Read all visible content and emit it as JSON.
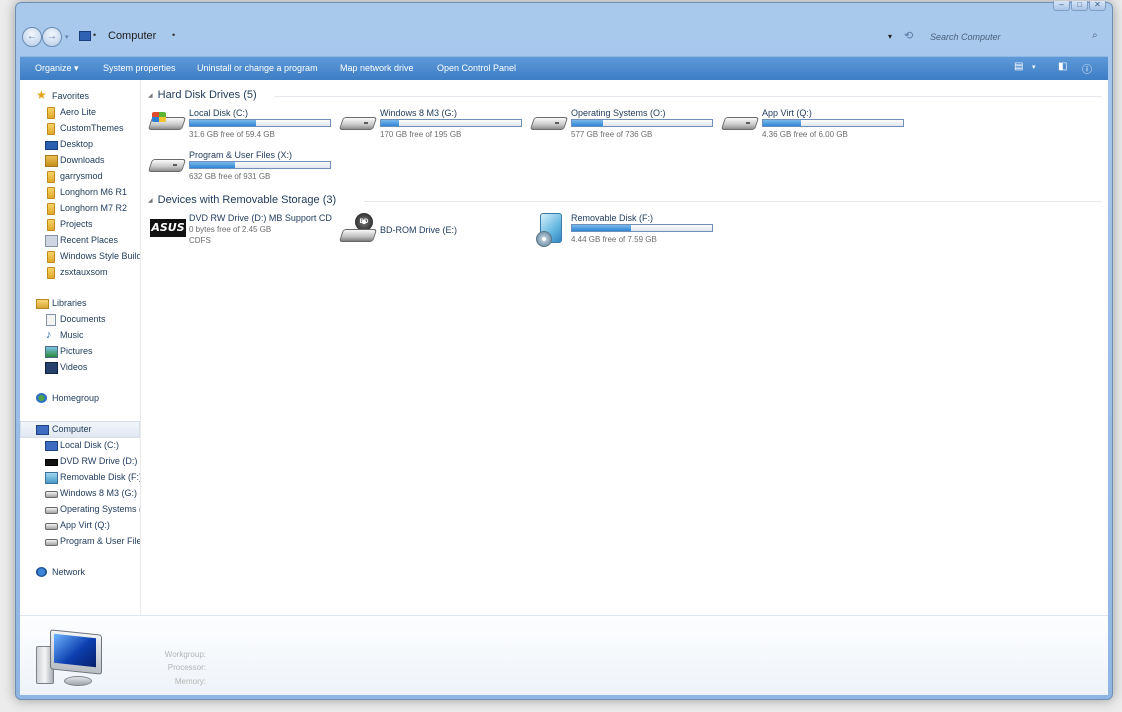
{
  "window": {
    "caption_buttons": [
      "–",
      "□",
      "✕"
    ]
  },
  "address": {
    "back": "←",
    "forward": "→",
    "location": "Computer",
    "search_placeholder": "Search Computer"
  },
  "toolbar": {
    "items": [
      "Organize ▾",
      "System properties",
      "Uninstall or change a program",
      "Map network drive",
      "Open Control Panel"
    ]
  },
  "nav": {
    "favorites_header": "Favorites",
    "favorites": [
      "Aero Lite",
      "CustomThemes",
      "Desktop",
      "Downloads",
      "garrysmod",
      "Longhorn M6 R1",
      "Longhorn M7 R2",
      "Projects",
      "Recent Places",
      "Windows Style Builder",
      "zsxtauxsom"
    ],
    "libraries_header": "Libraries",
    "libraries": [
      "Documents",
      "Music",
      "Pictures",
      "Videos"
    ],
    "homegroup": "Homegroup",
    "computer_header": "Computer",
    "computer_items": [
      "Local Disk (C:)",
      "DVD RW Drive (D:) MB Support CD",
      "Removable Disk (F:)",
      "Windows 8 M3 (G:)",
      "Operating Systems (O:)",
      "App Virt (Q:)",
      "Program & User Files (X:)"
    ],
    "network": "Network"
  },
  "groups": {
    "hdd_title": "Hard Disk Drives (5)",
    "removable_title": "Devices with Removable Storage (3)"
  },
  "hdd": [
    {
      "name": "Local Disk (C:)",
      "space": "31.6 GB free of 59.4 GB",
      "used": 0.47
    },
    {
      "name": "Windows 8 M3 (G:)",
      "space": "170 GB free of 195 GB",
      "used": 0.13
    },
    {
      "name": "Operating Systems (O:)",
      "space": "577 GB free of 736 GB",
      "used": 0.22
    },
    {
      "name": "App Virt (Q:)",
      "space": "4.36 GB free of 6.00 GB",
      "used": 0.27
    },
    {
      "name": "Program & User Files (X:)",
      "space": "632 GB free of 931 GB",
      "used": 0.32
    }
  ],
  "removable": [
    {
      "name": "DVD RW Drive (D:) MB Support CD",
      "space": "0 bytes free of 2.45 GB",
      "fs": "CDFS",
      "logo": "ASUS"
    },
    {
      "name": "BD-ROM Drive (E:)",
      "disc_label": "BD"
    },
    {
      "name": "Removable Disk (F:)",
      "space": "4.44 GB free of 7.59 GB",
      "used": 0.42
    }
  ],
  "details": {
    "labels": [
      "Workgroup:",
      "Processor:",
      "Memory:"
    ]
  }
}
